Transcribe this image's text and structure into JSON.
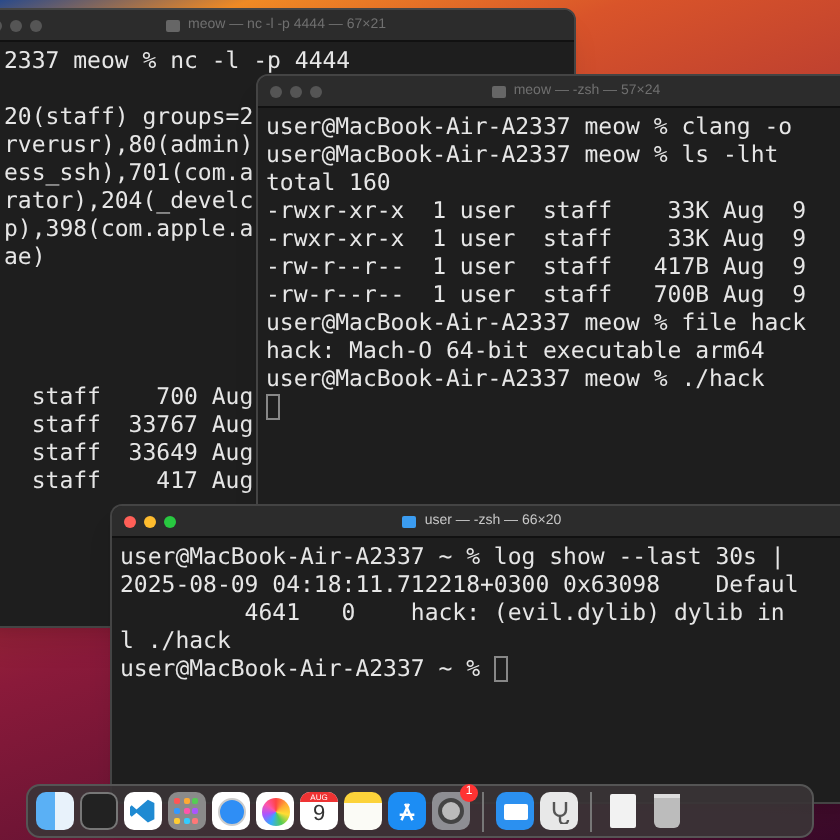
{
  "windows": [
    {
      "title": "meow — nc -l -p 4444 — 67×21",
      "active": false,
      "blocks": [
        [
          "2337 meow % nc -l -p 4444"
        ],
        [
          "20(staff) groups=2",
          "rverusr),80(admin)",
          "ess_ssh),701(com.a",
          "rator),204(_develc",
          "p),398(com.apple.a",
          "ae)"
        ],
        [
          "  staff    700 Aug",
          "  staff  33767 Aug",
          "  staff  33649 Aug",
          "  staff    417 Aug"
        ]
      ]
    },
    {
      "title": "meow — -zsh — 57×24",
      "active": false,
      "blocks": [
        [
          "user@MacBook-Air-A2337 meow % clang -o",
          "user@MacBook-Air-A2337 meow % ls -lht",
          "total 160",
          "-rwxr-xr-x  1 user  staff    33K Aug  9",
          "-rwxr-xr-x  1 user  staff    33K Aug  9",
          "-rw-r--r--  1 user  staff   417B Aug  9",
          "-rw-r--r--  1 user  staff   700B Aug  9",
          "user@MacBook-Air-A2337 meow % file hack",
          "hack: Mach-O 64-bit executable arm64",
          "user@MacBook-Air-A2337 meow % ./hack"
        ]
      ],
      "cursor_inline": false,
      "cursor_line": true
    },
    {
      "title": "user — -zsh — 66×20",
      "active": true,
      "blocks": [
        [
          "user@MacBook-Air-A2337 ~ % log show --last 30s |",
          "2025-08-09 04:18:11.712218+0300 0x63098    Defaul",
          "         4641   0    hack: (evil.dylib) dylib in",
          "l ./hack",
          "user@MacBook-Air-A2337 ~ %"
        ]
      ],
      "cursor_inline": true,
      "cursor_line": false
    }
  ],
  "dock": {
    "calendar_month": "AUG",
    "calendar_day": "9",
    "settings_badge": "1"
  }
}
